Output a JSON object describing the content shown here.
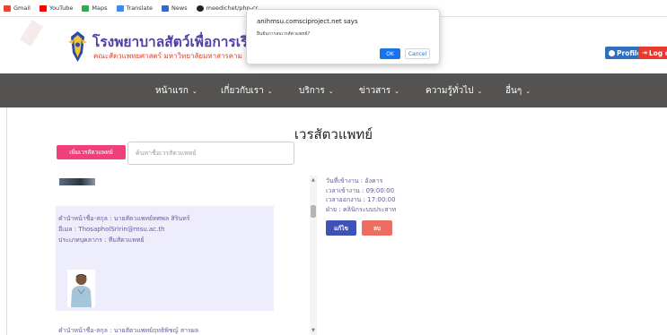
{
  "bookmarks": [
    {
      "label": "Gmail",
      "color": "#ea4335",
      "icon": "gmail-icon"
    },
    {
      "label": "YouTube",
      "color": "#ff0000",
      "icon": "youtube-icon"
    },
    {
      "label": "Maps",
      "color": "#34a853",
      "icon": "maps-icon"
    },
    {
      "label": "Translate",
      "color": "#4285f4",
      "icon": "translate-icon"
    },
    {
      "label": "News",
      "color": "#3b67c9",
      "icon": "news-icon"
    },
    {
      "label": "meedichet/php-cr...",
      "color": "#222222",
      "icon": "github-icon"
    }
  ],
  "header": {
    "title": "โรงพยาบาลสัตว์เพื่อการเรียนการสอน",
    "subtitle": "คณะสัตวแพทยศาสตร์ มหาวิทยาลัยมหาสารคาม",
    "profile_label": "Profile",
    "logout_label": "Log o"
  },
  "nav": {
    "items": [
      {
        "label": "หน้าแรก"
      },
      {
        "label": "เกี่ยวกับเรา"
      },
      {
        "label": "บริการ"
      },
      {
        "label": "ข่าวสาร"
      },
      {
        "label": "ความรู้ทั่วไป"
      },
      {
        "label": "อื่นๆ"
      }
    ]
  },
  "main": {
    "page_title": "เวรสัตวแพทย์",
    "add_button": "เพิ่มเวรสัตวแพทย์",
    "search_placeholder": "ค้นหาชื่อเวรสัตวแพทย์"
  },
  "vets": [
    {
      "name_line": "คำนำหน้าชื่อ-สกุล : นายสัตวแพทย์ทศพล สิรินทร์",
      "email_line": "อีเมล : ThosapholSririn@msu.ac.th",
      "type_line": "ประเภทบุคลากร : ทีมสัตวแพทย์"
    },
    {
      "name_line": "คำนำหน้าชื่อ-สกุล : นายสัตวแพทย์ฤทธิพิชญ์ สารผล"
    }
  ],
  "detail": {
    "day_line": "วันที่เข้างาน : อังคาร",
    "start_line": "เวลาเข้างาน : 09:00:00",
    "end_line": "เวลาออกงาน : 17:00:00",
    "dept_line": "ฝ่าย : คลินิกระบบประสาท",
    "edit_label": "แก้ไข",
    "delete_label": "ลบ"
  },
  "dialog": {
    "title": "anihmsu.comsciproject.net says",
    "message": "ยืนยันการลบเวรสัตวแพทย์?",
    "ok_label": "OK",
    "cancel_label": "Cancel"
  },
  "colors": {
    "nav_bg": "#555351",
    "brand_purple": "#4d3da8",
    "brand_red": "#e0402a",
    "add_button": "#f0407a",
    "edit_button": "#3e51b5",
    "delete_button": "#ec6e63",
    "card_bg": "#eeedfb"
  }
}
